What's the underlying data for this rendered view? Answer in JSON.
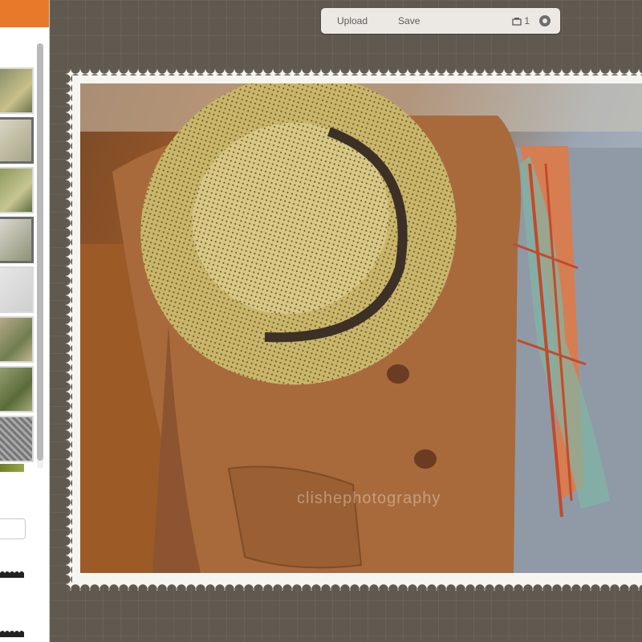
{
  "toolbar": {
    "upload_label": "Upload",
    "save_label": "Save",
    "counter": "1",
    "counter_icon": "stack-icon",
    "settings_icon": "gear-icon"
  },
  "photo": {
    "watermark": "clishephotography"
  },
  "colors": {
    "brand": "#e8782a",
    "canvas": "#5f594f",
    "frame": "#f7f5f1"
  }
}
